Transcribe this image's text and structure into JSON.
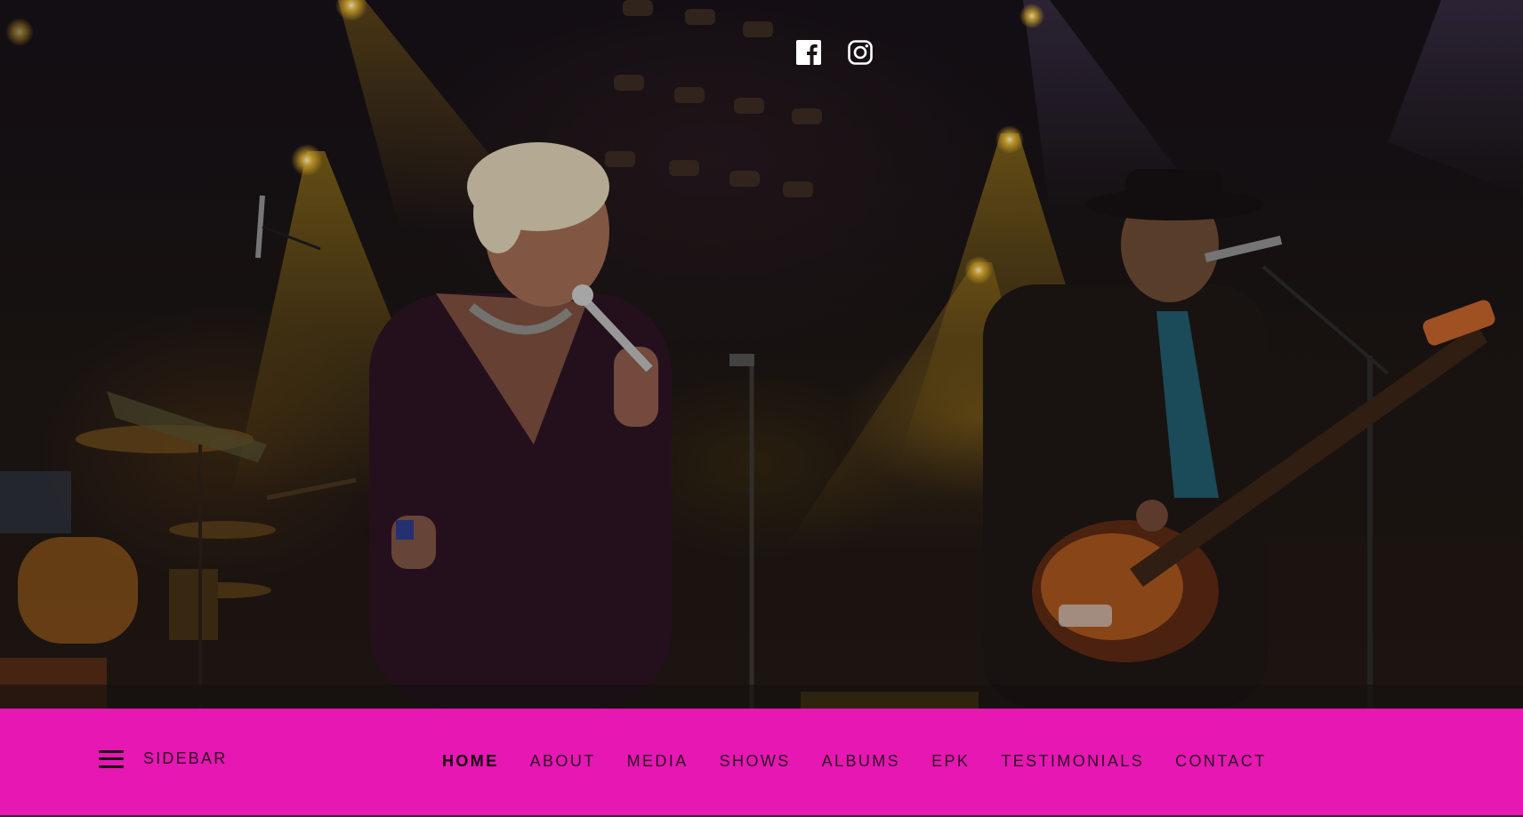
{
  "hero": {
    "image_description_icon": "stage-photo"
  },
  "social": {
    "items": [
      {
        "icon": "facebook-icon"
      },
      {
        "icon": "instagram-icon"
      }
    ]
  },
  "nav": {
    "sidebar_label": "SIDEBAR",
    "items": [
      {
        "label": "HOME",
        "active": true
      },
      {
        "label": "ABOUT",
        "active": false
      },
      {
        "label": "MEDIA",
        "active": false
      },
      {
        "label": "SHOWS",
        "active": false
      },
      {
        "label": "ALBUMS",
        "active": false
      },
      {
        "label": "EPK",
        "active": false
      },
      {
        "label": "TESTIMONIALS",
        "active": false
      },
      {
        "label": "CONTACT",
        "active": false
      }
    ]
  },
  "colors": {
    "nav_background": "#e617b2",
    "nav_text": "#2a0f24",
    "hero_dark": "#141015",
    "spotlight": "#d4a017"
  }
}
